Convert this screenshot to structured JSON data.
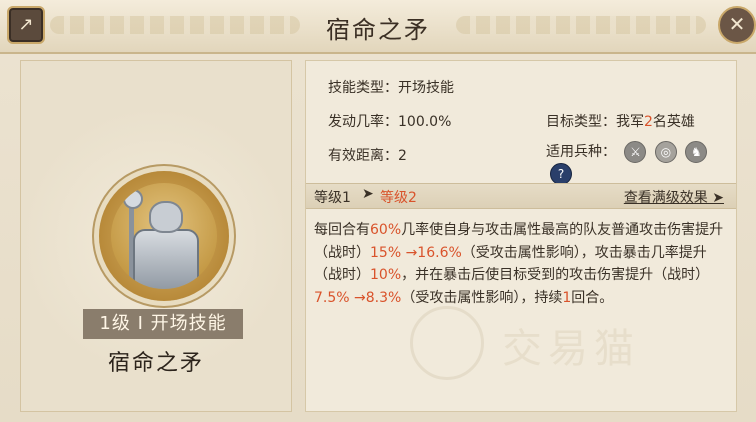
{
  "window": {
    "title": "宿命之矛"
  },
  "skill_card": {
    "badge": "1级 I 开场技能",
    "name": "宿命之矛",
    "portrait": "knight-portrait"
  },
  "info": {
    "skill_type": "技能类型：开场技能",
    "trigger_rate": "发动几率：100.0%",
    "distance": "有效距离：2",
    "target_prefix": "目标类型：我军",
    "target_num": "2",
    "target_suffix": "名英雄",
    "troops_label": "适用兵种：",
    "troop_icons": [
      "sword-icon",
      "target-icon",
      "horse-icon",
      "question-icon"
    ]
  },
  "levels": {
    "current": "等级1",
    "arrow": "➤",
    "next": "等级2",
    "max_link": "查看满级效果 ➤"
  },
  "description": [
    {
      "t": "每回合有",
      "h": false
    },
    {
      "t": "60%",
      "h": true
    },
    {
      "t": "几率使自身与攻击属性最高的队友普通攻击伤害提升（战时）",
      "h": false
    },
    {
      "t": "15% →16.6%",
      "h": true
    },
    {
      "t": "（受攻击属性影响），攻击暴击几率提升（战时）",
      "h": false
    },
    {
      "t": "10%",
      "h": true
    },
    {
      "t": "，并在暴击后使目标受到的攻击伤害提升（战时）",
      "h": false
    },
    {
      "t": "7.5% →8.3%",
      "h": true
    },
    {
      "t": "（受攻击属性影响），持续",
      "h": false
    },
    {
      "t": "1",
      "h": true
    },
    {
      "t": "回合。",
      "h": false
    }
  ],
  "watermark": {
    "text": "交易猫"
  },
  "colors": {
    "highlight": "#d9532b",
    "badge_bg": "#8a7d6c"
  }
}
